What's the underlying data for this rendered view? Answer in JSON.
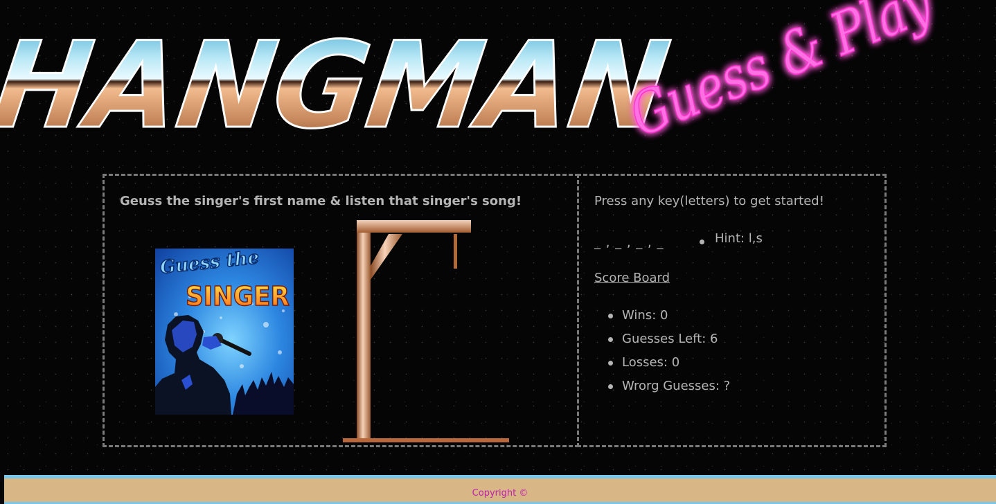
{
  "logo": {
    "title": "HANGMAN",
    "subtitle": "Guess & Play"
  },
  "game": {
    "instructions": "Geuss the singer's first name & listen that singer's song!",
    "singer_card_title_top": "Guess the",
    "singer_card_title_bottom": "SINGER"
  },
  "status": {
    "start_message": "Press any key(letters) to get started!",
    "word_display": "_ , _ , _ , _",
    "hint": "Hint: l,s"
  },
  "scoreboard": {
    "title": "Score Board",
    "stats": [
      {
        "label": "Wins: 0"
      },
      {
        "label": "Guesses Left: 6"
      },
      {
        "label": "Losses: 0"
      },
      {
        "label": "Wrorg Guesses: ?"
      }
    ]
  },
  "footer": {
    "copyright": "Copyright ©"
  },
  "colors": {
    "neon_pink": "#ff3fd6",
    "chrome_sky": "#79cbe6",
    "chrome_copper": "#c98a5c",
    "panel_border": "#7a7a7a",
    "text_gray": "#b5b5b5",
    "footer_tan": "#d9b685",
    "footer_border": "#7cc5ea",
    "copyright_magenta": "#c01fb0"
  }
}
